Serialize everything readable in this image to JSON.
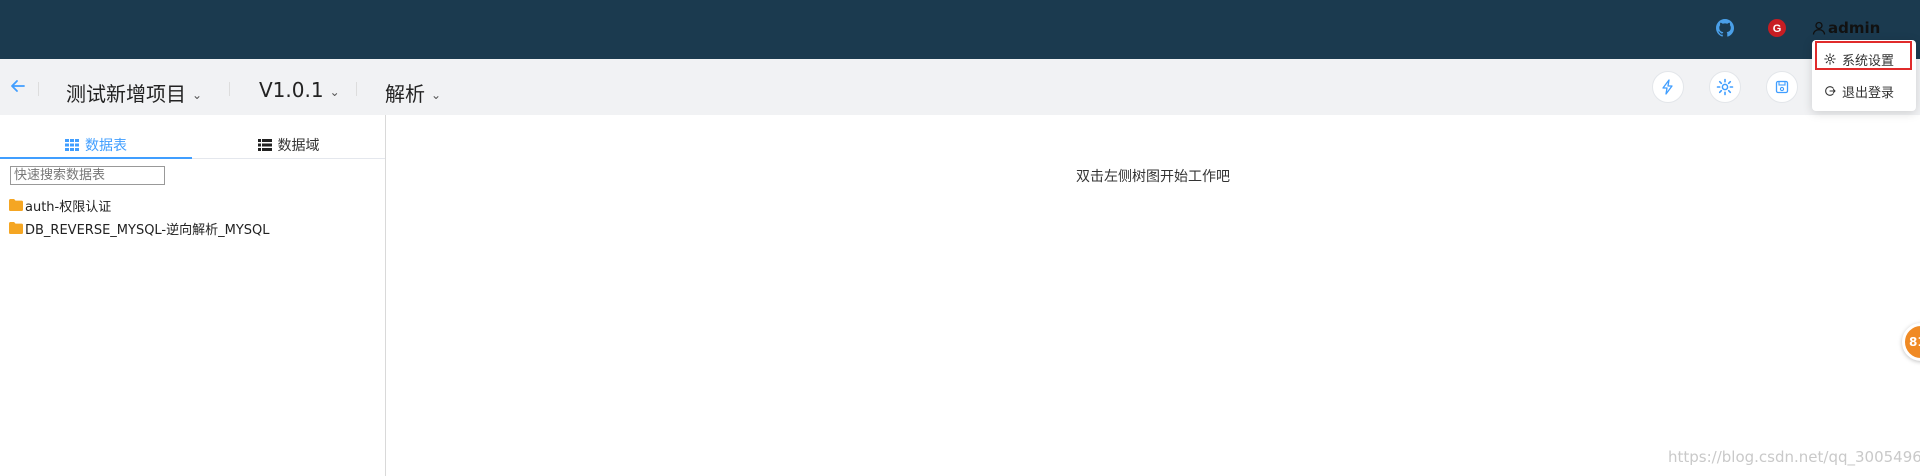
{
  "header": {
    "github_icon": "github-icon",
    "gitee_icon": "gitee-icon",
    "user_icon": "user-icon",
    "username": "admin"
  },
  "user_menu": {
    "items": [
      {
        "label": "系统设置",
        "icon": "gear-icon",
        "highlighted": true
      },
      {
        "label": "退出登录",
        "icon": "logout-icon",
        "highlighted": false
      }
    ]
  },
  "project_bar": {
    "back_icon": "arrow-left-icon",
    "project_name": "测试新增项目",
    "version": "V1.0.1",
    "mode": "解析",
    "actions": [
      {
        "icon": "lightning-icon"
      },
      {
        "icon": "gear-icon"
      },
      {
        "icon": "save-icon"
      }
    ]
  },
  "left_panel": {
    "tabs": [
      {
        "label": "数据表",
        "icon": "grid-icon",
        "active": true
      },
      {
        "label": "数据域",
        "icon": "list-icon",
        "active": false
      }
    ],
    "search": {
      "placeholder": "快速搜索数据表",
      "value": ""
    },
    "tree": [
      {
        "label": "auth-权限认证",
        "icon": "folder-icon"
      },
      {
        "label": "DB_REVERSE_MYSQL-逆向解析_MYSQL",
        "icon": "folder-icon"
      }
    ]
  },
  "main": {
    "empty_hint": "双击左侧树图开始工作吧"
  },
  "floating_badge": {
    "text": "81"
  },
  "watermark": "https://blog.csdn.net/qq_30054961",
  "colors": {
    "header_bg": "#1b3a4f",
    "accent": "#409eff",
    "folder": "#f5a623",
    "highlight_border": "#e02b2b",
    "badge": "#f08a24"
  }
}
